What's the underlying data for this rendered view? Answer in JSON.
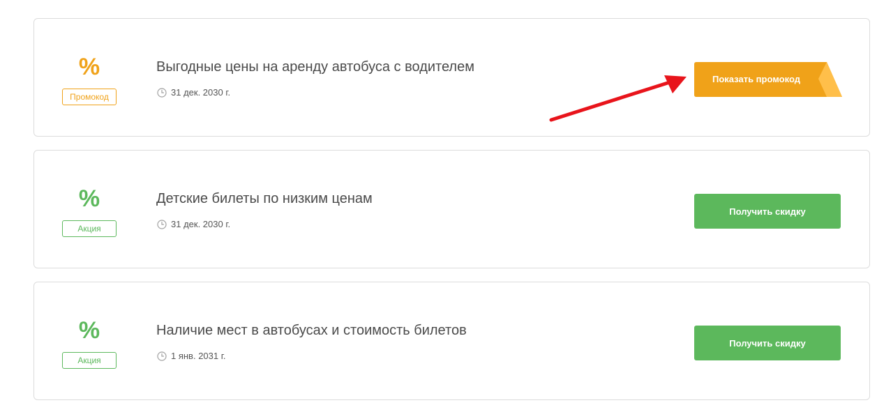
{
  "offers": [
    {
      "icon": "percent-icon",
      "tag": "Промокод",
      "title": "Выгодные цены на аренду автобуса с водителем",
      "date": "31 дек. 2030 г.",
      "button": "Показать промокод"
    },
    {
      "icon": "percent-icon",
      "tag": "Акция",
      "title": "Детские билеты по низким ценам",
      "date": "31 дек. 2030 г.",
      "button": "Получить скидку"
    },
    {
      "icon": "percent-icon",
      "tag": "Акция",
      "title": "Наличие мест в автобусах и стоимость билетов",
      "date": "1 янв. 2031 г.",
      "button": "Получить скидку"
    }
  ],
  "symbols": {
    "percent": "%"
  },
  "colors": {
    "promo_orange": "#f0a219",
    "promo_fold": "#ffbf4a",
    "sale_green": "#5cb85c",
    "annotation_arrow": "#e8141b",
    "title_text": "#4a4a4a",
    "border": "#dcdcdc"
  }
}
